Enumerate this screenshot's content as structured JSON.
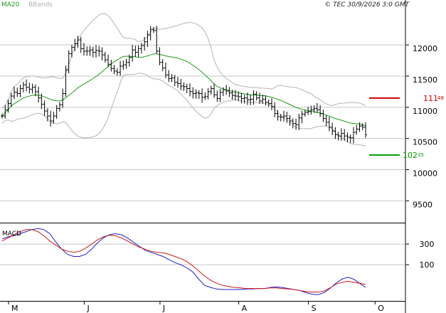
{
  "header": {
    "legend_ma": "MA20",
    "legend_bb": "BBands",
    "copyright": "© TEC 30/9/2026 3:0 GMT"
  },
  "colors": {
    "ma": "#1a9c1a",
    "bbands": "#b4b4b4",
    "bars": "#000000",
    "macd_line": "#2020c8",
    "signal_line": "#c81818",
    "resistance": "#cc0000",
    "support": "#009900",
    "grid": "#c8c8c8"
  },
  "chart_data": [
    {
      "type": "ohlc",
      "y_ticks": [
        "9500",
        "10000",
        "10500",
        "11000",
        "11500",
        "12000"
      ],
      "y_tick_values": [
        9500,
        10000,
        10500,
        11000,
        11500,
        12000
      ],
      "ylim": [
        9150,
        12720
      ],
      "month_labels": [
        "M",
        "J",
        "J",
        "A",
        "S",
        "O"
      ],
      "month_index": [
        0,
        25,
        50,
        76,
        99,
        121
      ],
      "n_days": 121,
      "closes": [
        10860,
        10960,
        11060,
        11180,
        11240,
        11220,
        11300,
        11360,
        11320,
        11290,
        11320,
        11250,
        11150,
        11050,
        10940,
        10860,
        10780,
        10860,
        10980,
        11040,
        11220,
        11600,
        11860,
        11960,
        12020,
        12080,
        11940,
        11900,
        11900,
        11920,
        11880,
        11910,
        11900,
        11840,
        11760,
        11690,
        11620,
        11580,
        11560,
        11660,
        11680,
        11720,
        11800,
        11920,
        11880,
        11940,
        11990,
        12050,
        12160,
        12250,
        12230,
        11900,
        11720,
        11630,
        11520,
        11460,
        11470,
        11400,
        11380,
        11340,
        11330,
        11300,
        11250,
        11220,
        11230,
        11220,
        11160,
        11170,
        11250,
        11300,
        11200,
        11140,
        11240,
        11280,
        11260,
        11230,
        11190,
        11180,
        11170,
        11140,
        11150,
        11120,
        11130,
        11210,
        11150,
        11100,
        11130,
        11080,
        11060,
        11010,
        10900,
        10850,
        10840,
        10860,
        10820,
        10780,
        10740,
        10720,
        10830,
        10890,
        10920,
        10930,
        10960,
        10980,
        10960,
        10900,
        10820,
        10760,
        10680,
        10620,
        10560,
        10540,
        10580,
        10540,
        10520,
        10510,
        10600,
        10650,
        10700,
        10680,
        10560
      ],
      "resistance": {
        "label": "111",
        "decimals": "48",
        "value": 11148
      },
      "support": {
        "label": "102",
        "decimals": "35",
        "value": 10235
      }
    },
    {
      "type": "line",
      "title": "MACD",
      "y_ticks": [
        "100",
        "300"
      ],
      "y_tick_values": [
        100,
        300
      ],
      "ylim": [
        -250,
        500
      ],
      "series": [
        {
          "values": [
            350,
            370,
            380,
            400,
            420,
            440,
            450,
            440,
            400,
            320,
            250,
            200,
            180,
            180,
            200,
            250,
            310,
            360,
            390,
            400,
            390,
            360,
            320,
            280,
            240,
            220,
            200,
            180,
            150,
            120,
            100,
            70,
            30,
            -40,
            -100,
            -120,
            -135,
            -140,
            -140,
            -140,
            -140,
            -135,
            -135,
            -130,
            -130,
            -120,
            -115,
            -120,
            -130,
            -140,
            -150,
            -170,
            -185,
            -190,
            -170,
            -130,
            -80,
            -40,
            -20,
            -40,
            -80,
            -120
          ]
        },
        {
          "values": [
            330,
            360,
            390,
            420,
            440,
            440,
            420,
            380,
            330,
            290,
            250,
            230,
            220,
            230,
            260,
            300,
            340,
            370,
            385,
            380,
            360,
            330,
            300,
            270,
            250,
            230,
            220,
            215,
            200,
            180,
            160,
            130,
            90,
            40,
            -10,
            -50,
            -80,
            -100,
            -110,
            -120,
            -125,
            -130,
            -130,
            -130,
            -130,
            -125,
            -125,
            -130,
            -135,
            -140,
            -150,
            -160,
            -165,
            -165,
            -155,
            -125,
            -90,
            -70,
            -60,
            -70,
            -80,
            -90
          ]
        }
      ]
    }
  ]
}
